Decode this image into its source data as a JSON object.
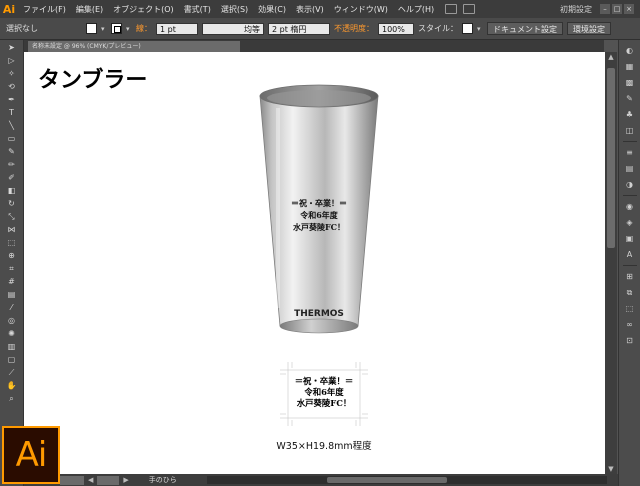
{
  "app": {
    "logo_small": "Ai",
    "logo_big": "Ai",
    "workspace_label": "初期設定"
  },
  "menu": {
    "items": [
      "ファイル(F)",
      "編集(E)",
      "オブジェクト(O)",
      "書式(T)",
      "選択(S)",
      "効果(C)",
      "表示(V)",
      "ウィンドウ(W)",
      "ヘルプ(H)"
    ]
  },
  "control": {
    "selection_status": "選択なし",
    "stroke_label": "線：",
    "stroke_weight": "1 pt",
    "profile_label": "均等",
    "brush_label": "2 pt 楕円",
    "opacity_label": "不透明度：",
    "opacity_value": "100%",
    "style_label": "スタイル：",
    "doc_setup_button": "ドキュメント設定",
    "prefs_button": "環境設定"
  },
  "document": {
    "tab_title": "名称未設定 @ 96% (CMYK/プレビュー)",
    "title": "タンブラー",
    "imprint_lines": [
      "＝祝・卒業！＝",
      "令和6年度",
      "水戸葵陵FC！"
    ],
    "brand": "THERMOS",
    "size_caption": "W35×H19.8mm程度"
  },
  "status": {
    "tool_name": "手のひら"
  },
  "colors": {
    "accent": "#ff9a00",
    "menubar": "#3c3c3c",
    "panel": "#4c4c4c",
    "canvas": "#ffffff"
  },
  "tools": [
    "selection-icon",
    "direct-selection-icon",
    "magic-wand-icon",
    "lasso-icon",
    "pen-icon",
    "type-icon",
    "line-icon",
    "rectangle-icon",
    "paintbrush-icon",
    "pencil-icon",
    "blob-brush-icon",
    "eraser-icon",
    "rotate-icon",
    "scale-icon",
    "width-icon",
    "free-transform-icon",
    "shape-builder-icon",
    "perspective-icon",
    "mesh-icon",
    "gradient-icon",
    "eyedropper-icon",
    "blend-icon",
    "symbol-sprayer-icon",
    "graph-icon",
    "artboard-icon",
    "slice-icon",
    "hand-icon",
    "zoom-icon"
  ],
  "right_panels": [
    "color-icon",
    "color-guide-icon",
    "swatches-icon",
    "brushes-icon",
    "symbols-icon",
    "graphic-styles-icon",
    "stroke-icon",
    "gradient-panel-icon",
    "transparency-icon",
    "appearance-icon",
    "layers-icon",
    "artboards-panel-icon",
    "character-icon",
    "align-icon",
    "pathfinder-icon",
    "transform-icon",
    "links-icon",
    "navigator-icon"
  ]
}
